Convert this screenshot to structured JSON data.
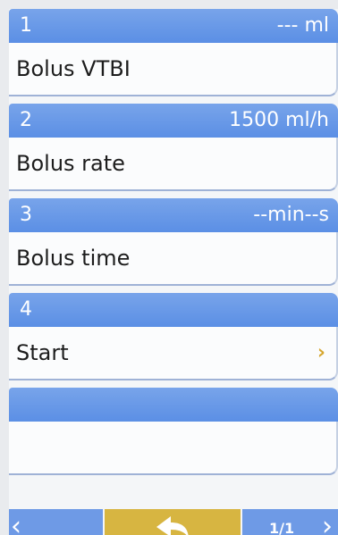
{
  "items": [
    {
      "num": "1",
      "value": "--- ml",
      "label": "Bolus VTBI"
    },
    {
      "num": "2",
      "value": "1500 ml/h",
      "label": "Bolus rate"
    },
    {
      "num": "3",
      "value": "--min--s",
      "label": "Bolus time"
    },
    {
      "num": "4",
      "value": "",
      "label": "Start",
      "chevron": "›"
    }
  ],
  "nav": {
    "prev": "‹",
    "page": "1/1",
    "next": "›"
  },
  "colors": {
    "header_blue": "#5b8fe5",
    "back_button_yellow": "#d7b541",
    "chevron_gold": "#d6a730"
  },
  "icons": {
    "back": "back-arrow-icon",
    "prev": "chevron-left-icon",
    "next": "chevron-right-icon",
    "item_next": "chevron-right-icon"
  }
}
